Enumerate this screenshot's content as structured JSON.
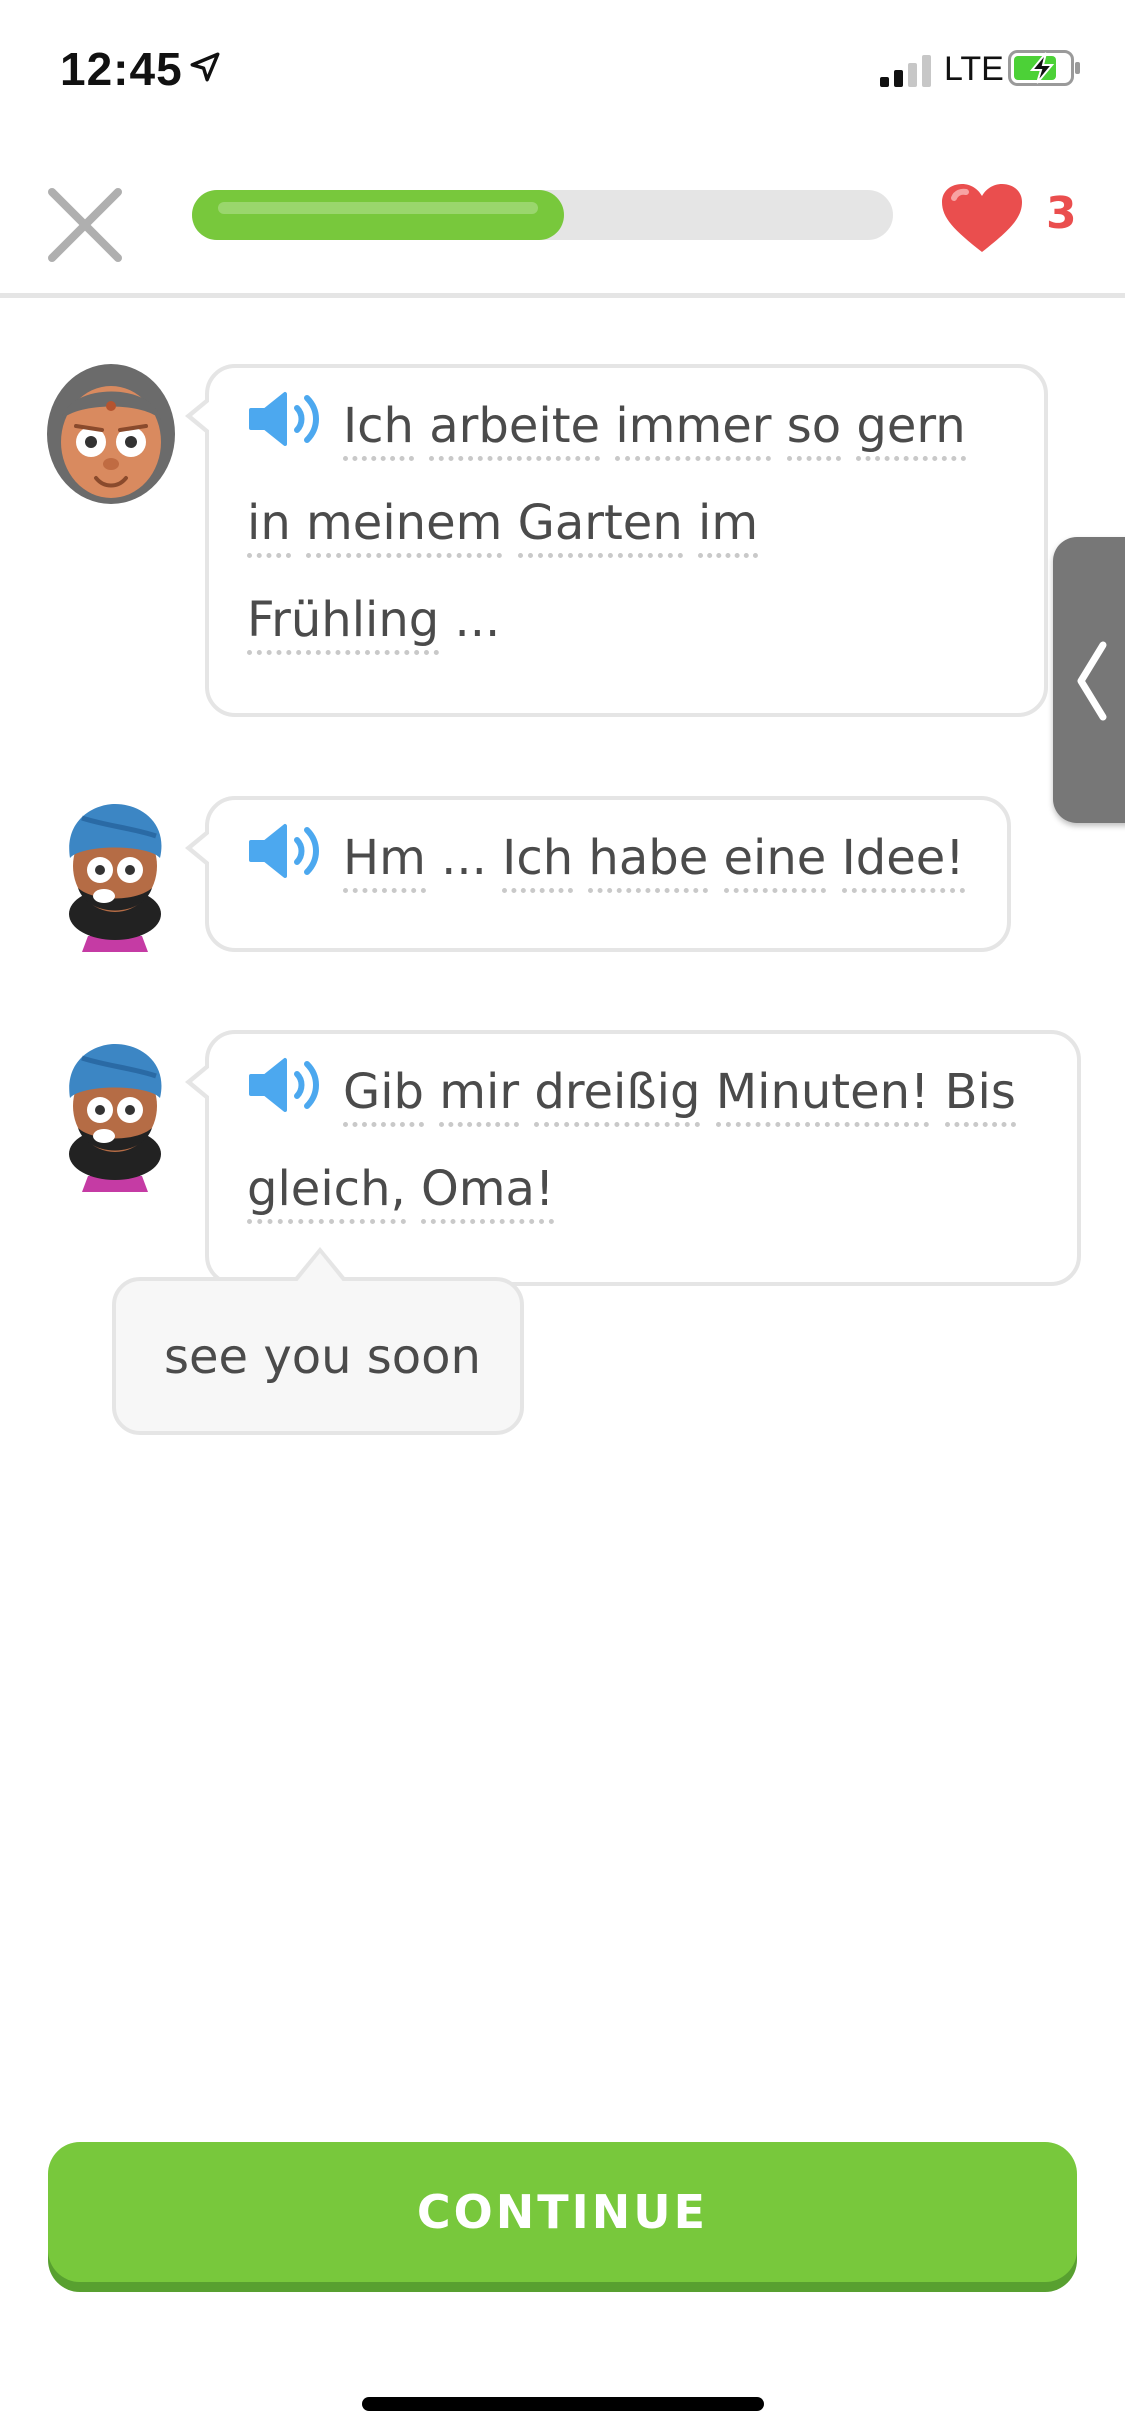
{
  "status_bar": {
    "time": "12:45",
    "network": "LTE",
    "icons": [
      "location-arrow-icon",
      "signal-icon",
      "battery-charging-icon"
    ]
  },
  "header": {
    "close_icon": "close-icon",
    "progress_fraction": 0.53,
    "hearts_count": "3",
    "heart_icon": "heart-icon"
  },
  "colors": {
    "progress_green": "#78c83c",
    "heart_red": "#ea4e4e",
    "speaker_blue": "#4ca8ef",
    "button_green": "#78c83c"
  },
  "messages": [
    {
      "speaker": "grandma",
      "words": [
        "Ich",
        "arbeite",
        "immer",
        "so",
        "gern",
        "in",
        "meinem",
        "Garten",
        "im",
        "Frühling",
        "..."
      ]
    },
    {
      "speaker": "boy",
      "words": [
        "Hm",
        "...",
        "Ich",
        "habe",
        "eine",
        "Idee!"
      ]
    },
    {
      "speaker": "boy",
      "words": [
        "Gib",
        "mir",
        "dreißig",
        "Minuten!",
        "Bis",
        "gleich,",
        "Oma!"
      ]
    }
  ],
  "tooltip": {
    "text": "see you soon"
  },
  "continue_button": {
    "label": "CONTINUE"
  }
}
